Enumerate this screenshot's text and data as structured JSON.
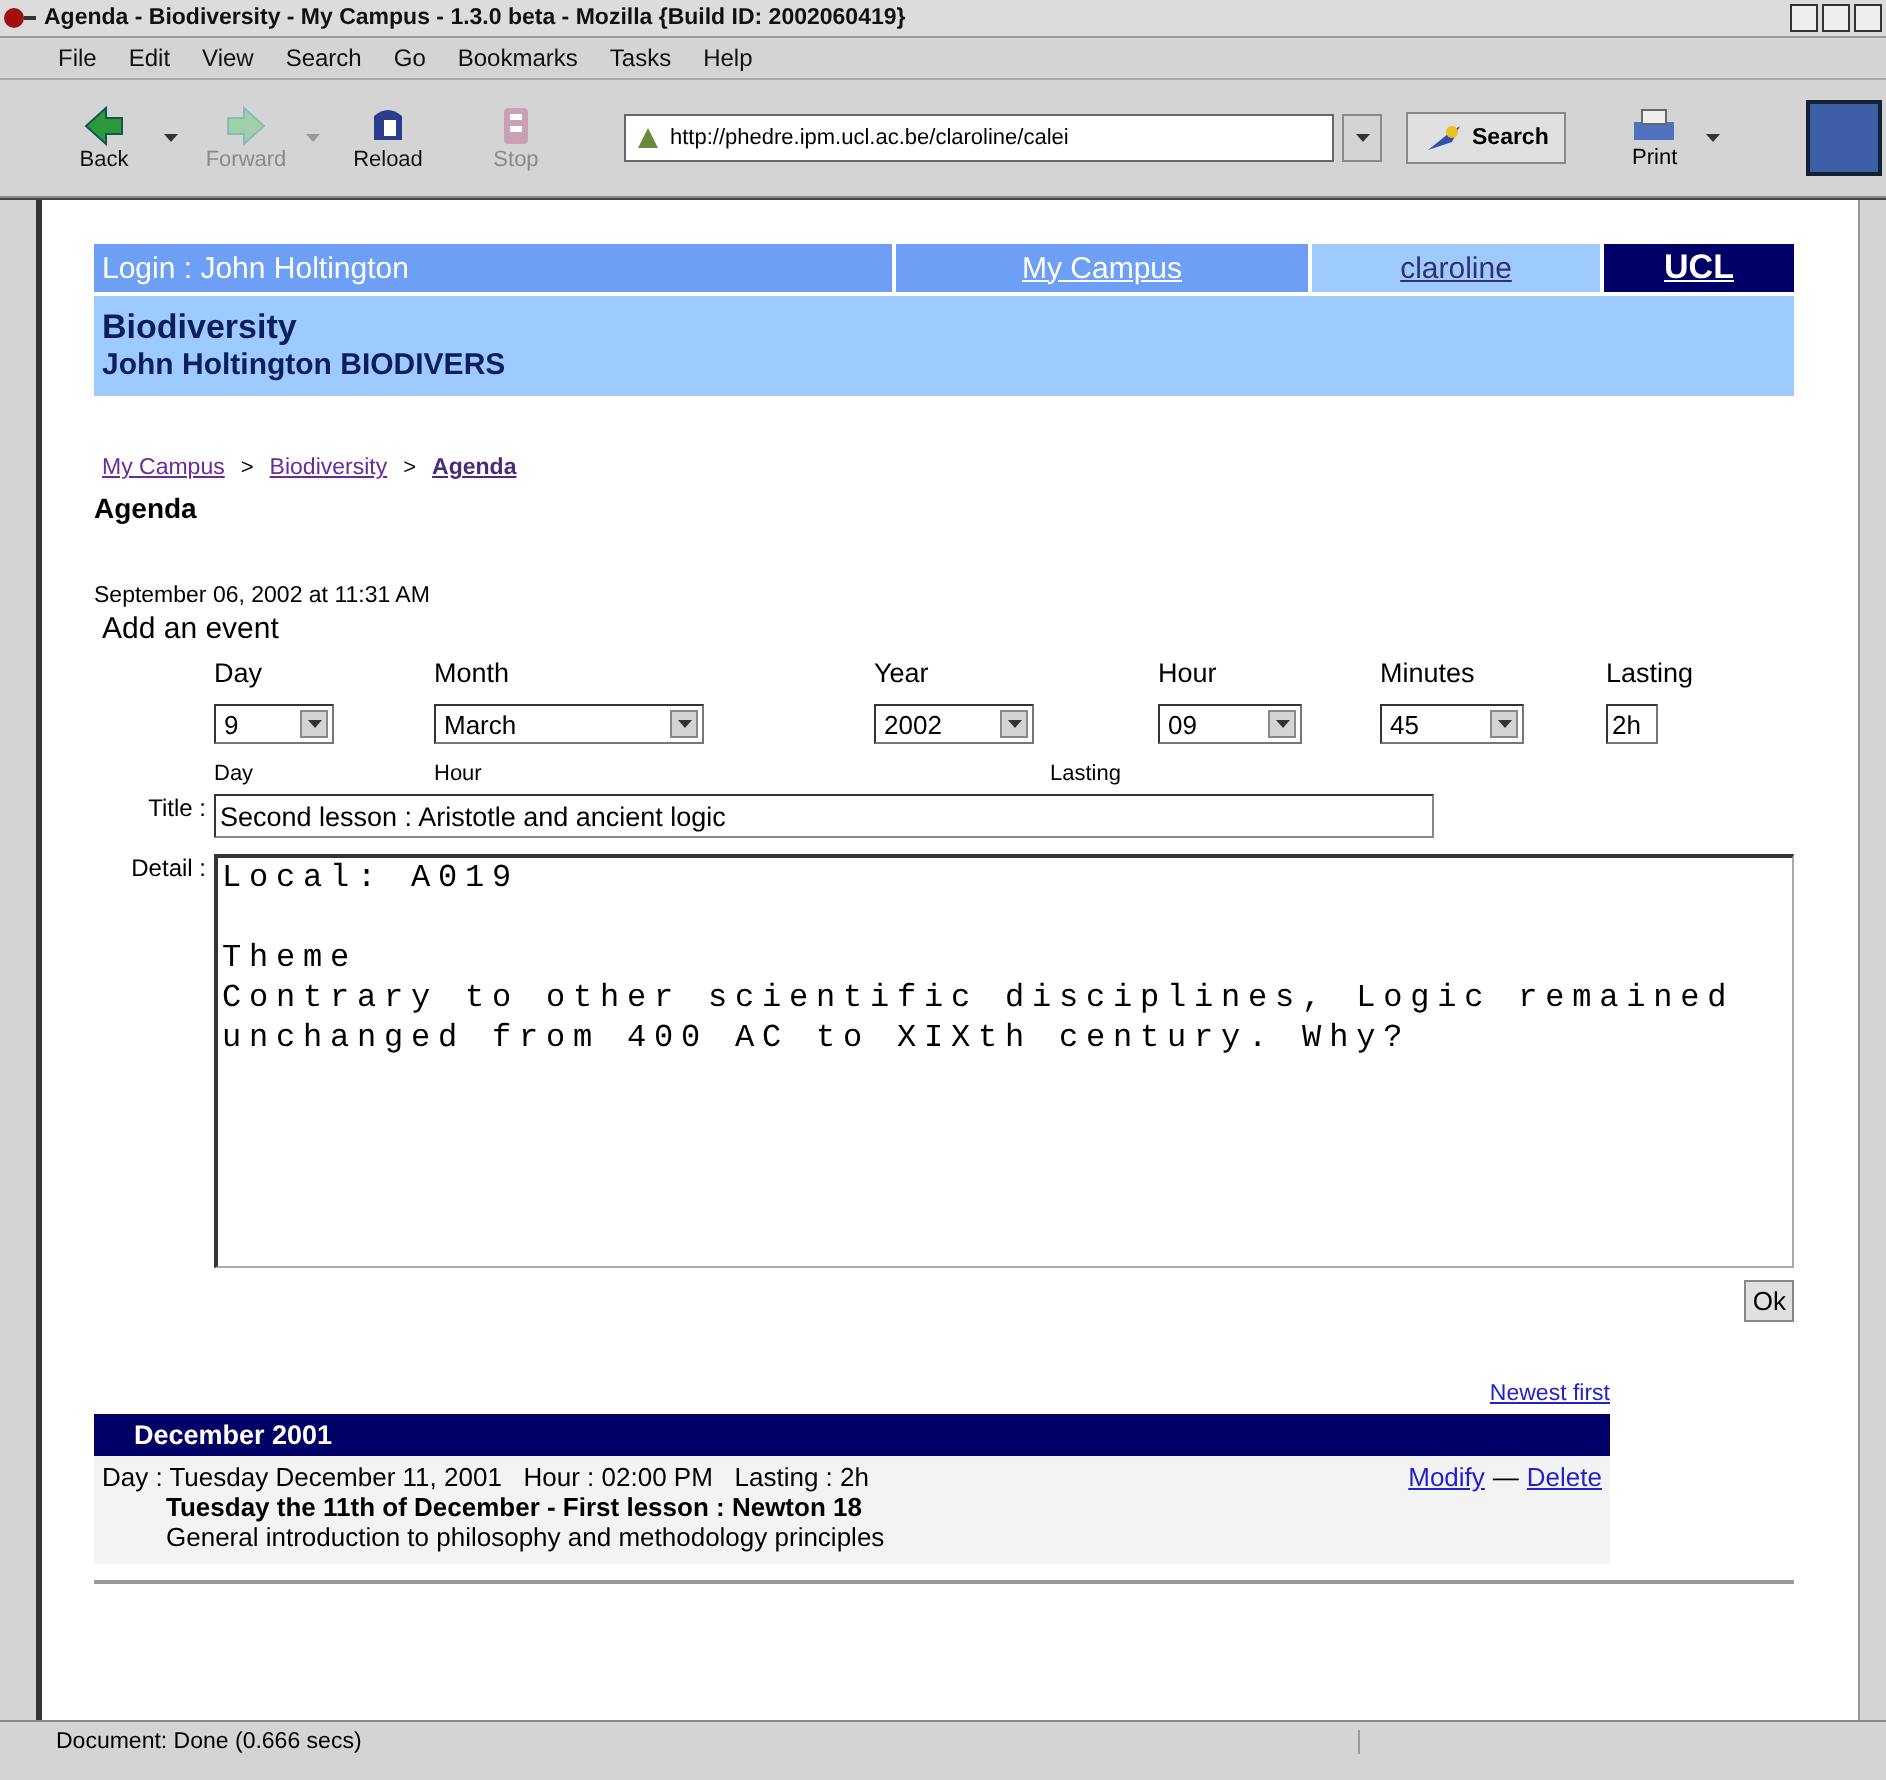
{
  "window": {
    "title": "Agenda - Biodiversity - My Campus - 1.3.0 beta - Mozilla {Build ID: 2002060419}"
  },
  "menu": [
    "File",
    "Edit",
    "View",
    "Search",
    "Go",
    "Bookmarks",
    "Tasks",
    "Help"
  ],
  "toolbar": [
    {
      "label": "Back",
      "kind": "back",
      "disabled": false
    },
    {
      "label": "Forward",
      "kind": "forward",
      "disabled": true
    },
    {
      "label": "Reload",
      "kind": "reload",
      "disabled": false
    },
    {
      "label": "Stop",
      "kind": "stop",
      "disabled": true
    }
  ],
  "address": "http://phedre.ipm.ucl.ac.be/claroline/calei",
  "search_button": "Search",
  "print_button": "Print",
  "header": {
    "login": "Login : John Holtington",
    "links": [
      "My Campus",
      "claroline"
    ],
    "logo": "UCL"
  },
  "course": {
    "title": "Biodiversity",
    "subtitle": "John Holtington BIODIVERS"
  },
  "breadcrumb": [
    {
      "label": "My Campus",
      "current": false
    },
    {
      "label": "Biodiversity",
      "current": false
    },
    {
      "label": "Agenda",
      "current": true
    }
  ],
  "breadcrumb_separator": ">",
  "page_heading": "Agenda",
  "date": "September 06, 2002 at 11:31 AM",
  "form": {
    "heading": "Add an event",
    "fields": [
      {
        "label": "Day",
        "value": "9",
        "kind": "select"
      },
      {
        "label": "Month",
        "value": "March",
        "kind": "select"
      },
      {
        "label": "Year",
        "value": "2002",
        "kind": "select"
      },
      {
        "label": "Hour",
        "value": "09",
        "kind": "select"
      },
      {
        "label": "Minutes",
        "value": "45",
        "kind": "select"
      },
      {
        "label": "Lasting",
        "value": "2h",
        "kind": "text"
      }
    ],
    "sublabels": [
      "Day",
      "Hour",
      "Lasting"
    ],
    "title_label": "Title :",
    "title_value": "Second lesson : Aristotle and ancient logic",
    "detail_label": "Detail :",
    "detail_value": "Local: A019\n\nTheme\nContrary to other scientific disciplines, Logic remained\nunchanged from 400 AC to XIXth century. Why?",
    "ok": "Ok"
  },
  "agenda": {
    "sort_link": "Newest first",
    "month": "December 2001",
    "events": [
      {
        "meta": "Day : Tuesday December 11, 2001   Hour : 02:00 PM   Lasting : 2h",
        "actions": [
          "Modify",
          "Delete"
        ],
        "separator": "—",
        "title": "Tuesday the 11th of December - First lesson : Newton 18",
        "description": "General introduction to philosophy and methodology principles"
      }
    ]
  },
  "status_bar": "Document: Done (0.666 secs)"
}
